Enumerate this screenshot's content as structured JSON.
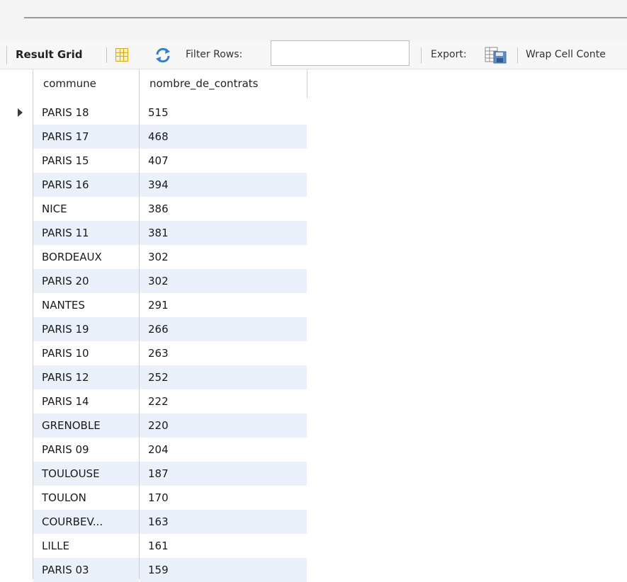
{
  "toolbar": {
    "result_grid_label": "Result Grid",
    "filter_label": "Filter Rows:",
    "filter_value": "",
    "export_label": "Export:",
    "wrap_label": "Wrap Cell Conte",
    "icons": [
      "grid-layout-icon",
      "refresh-icon",
      "export-icon"
    ]
  },
  "grid": {
    "columns": [
      "commune",
      "nombre_de_contrats"
    ],
    "selected_row": 0,
    "rows": [
      [
        "PARIS 18",
        "515"
      ],
      [
        "PARIS 17",
        "468"
      ],
      [
        "PARIS 15",
        "407"
      ],
      [
        "PARIS 16",
        "394"
      ],
      [
        "NICE",
        "386"
      ],
      [
        "PARIS 11",
        "381"
      ],
      [
        "BORDEAUX",
        "302"
      ],
      [
        "PARIS 20",
        "302"
      ],
      [
        "NANTES",
        "291"
      ],
      [
        "PARIS 19",
        "266"
      ],
      [
        "PARIS 10",
        "263"
      ],
      [
        "PARIS 12",
        "252"
      ],
      [
        "PARIS 14",
        "222"
      ],
      [
        "GRENOBLE",
        "220"
      ],
      [
        "PARIS 09",
        "204"
      ],
      [
        "TOULOUSE",
        "187"
      ],
      [
        "TOULON",
        "170"
      ],
      [
        "COURBEV...",
        "163"
      ],
      [
        "LILLE",
        "161"
      ],
      [
        "PARIS 03",
        "159"
      ]
    ]
  },
  "colors": {
    "alt_row": "#eaf1fb",
    "grid_line": "#cfcfcf"
  }
}
